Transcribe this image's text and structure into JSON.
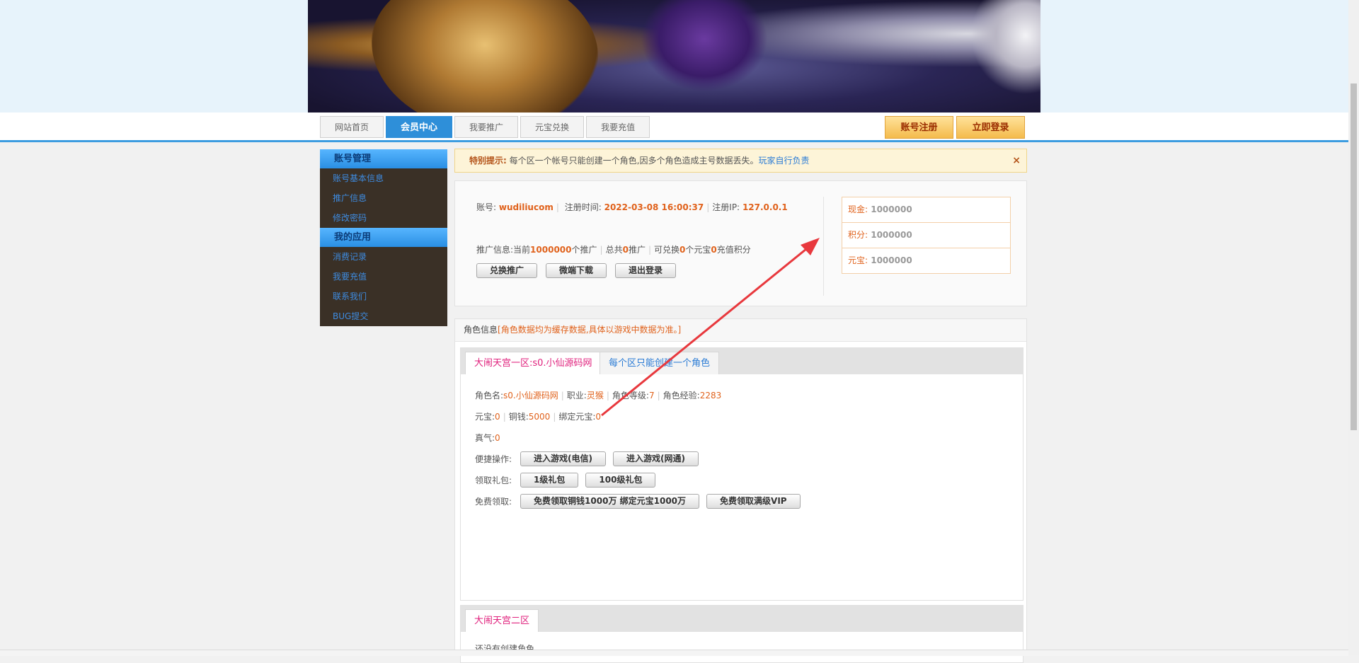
{
  "nav": {
    "tabs": [
      "网站首页",
      "会员中心",
      "我要推广",
      "元宝兑换",
      "我要充值"
    ],
    "active_index": 1,
    "register": "账号注册",
    "login": "立即登录"
  },
  "sidebar": {
    "section1": {
      "title": "账号管理",
      "items": [
        "账号基本信息",
        "推广信息",
        "修改密码"
      ]
    },
    "section2": {
      "title": "我的应用",
      "items": [
        "消费记录",
        "我要充值",
        "联系我们",
        "BUG提交"
      ]
    }
  },
  "notice": {
    "label": "特别提示:",
    "text": "每个区一个帐号只能创建一个角色,因多个角色造成主号数据丢失。",
    "link": "玩家自行负责",
    "close": "×"
  },
  "account": {
    "account_label": "账号:",
    "account": "wudiliucom",
    "reg_time_label": "注册时间:",
    "reg_time": "2022-03-08 16:00:37",
    "reg_ip_label": "注册IP:",
    "reg_ip": "127.0.0.1",
    "promo_prefix": "推广信息:当前",
    "promo_count": "1000000",
    "promo_unit": "个推广",
    "total_prefix": "总共",
    "total_count": "0",
    "total_unit": "推广",
    "exch_prefix": "可兑换",
    "exch_count": "0",
    "exch_mid": "个元宝",
    "exch_count2": "0",
    "exch_suffix": "充值积分",
    "buttons": [
      "兑换推广",
      "微端下载",
      "退出登录"
    ]
  },
  "wallet": [
    {
      "label": "现金:",
      "value": "1000000"
    },
    {
      "label": "积分:",
      "value": "1000000"
    },
    {
      "label": "元宝:",
      "value": "1000000"
    }
  ],
  "roles": {
    "title": "角色信息",
    "title_note": "[角色数据均为缓存数据,具体以游戏中数据为准。]",
    "server1": {
      "tab": "大闹天宫一区:s0.小仙源码网",
      "tab2": "每个区只能创建一个角色",
      "name_label": "角色名:",
      "name": "s0.小仙源码网",
      "job_label": "职业:",
      "job": "灵猴",
      "level_label": "角色等级:",
      "level": "7",
      "exp_label": "角色经验:",
      "exp": "2283",
      "yb_label": "元宝:",
      "yb": "0",
      "coin_label": "铜钱:",
      "coin": "5000",
      "bind_label": "绑定元宝:",
      "bind": "0",
      "qi_label": "真气:",
      "qi": "0",
      "quick_label": "便捷操作:",
      "quick_buttons": [
        "进入游戏(电信)",
        "进入游戏(网通)"
      ],
      "gift_label": "领取礼包:",
      "gift_buttons": [
        "1级礼包",
        "100级礼包"
      ],
      "free_label": "免费领取:",
      "free_buttons": [
        "免费领取铜钱1000万 绑定元宝1000万",
        "免费领取满级VIP"
      ]
    },
    "server2": {
      "tab": "大闹天宫二区",
      "empty": "还没有创建角色"
    }
  },
  "colors": {
    "accent_blue": "#2e8fd9",
    "orange": "#e0621c",
    "pink": "#e0217d",
    "arrow": "#e8383d"
  }
}
